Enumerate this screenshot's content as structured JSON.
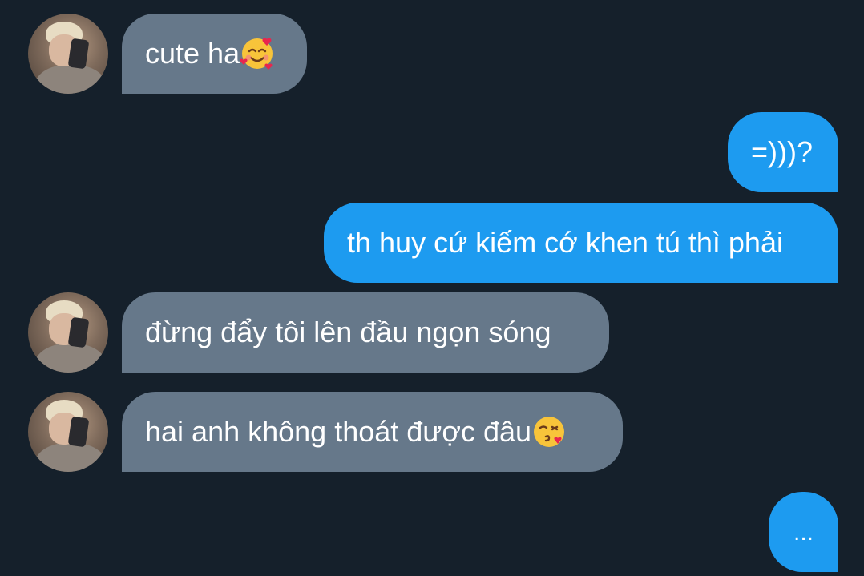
{
  "messages": [
    {
      "side": "in",
      "text": "cute ha",
      "emoji": "smiling-face-with-hearts-icon"
    },
    {
      "side": "out",
      "text": "=)))?"
    },
    {
      "side": "out",
      "text": "th huy cứ kiếm cớ khen tú thì phải"
    },
    {
      "side": "in",
      "text": "đừng đẩy tôi lên đầu ngọn sóng"
    },
    {
      "side": "in",
      "text": "hai anh không thoát được đâu",
      "emoji": "face-blowing-kiss-icon"
    },
    {
      "side": "out",
      "text": "..."
    }
  ],
  "colors": {
    "background": "#15202b",
    "incoming_bubble": "#66788a",
    "outgoing_bubble": "#1d9bf0",
    "text": "#ffffff"
  }
}
